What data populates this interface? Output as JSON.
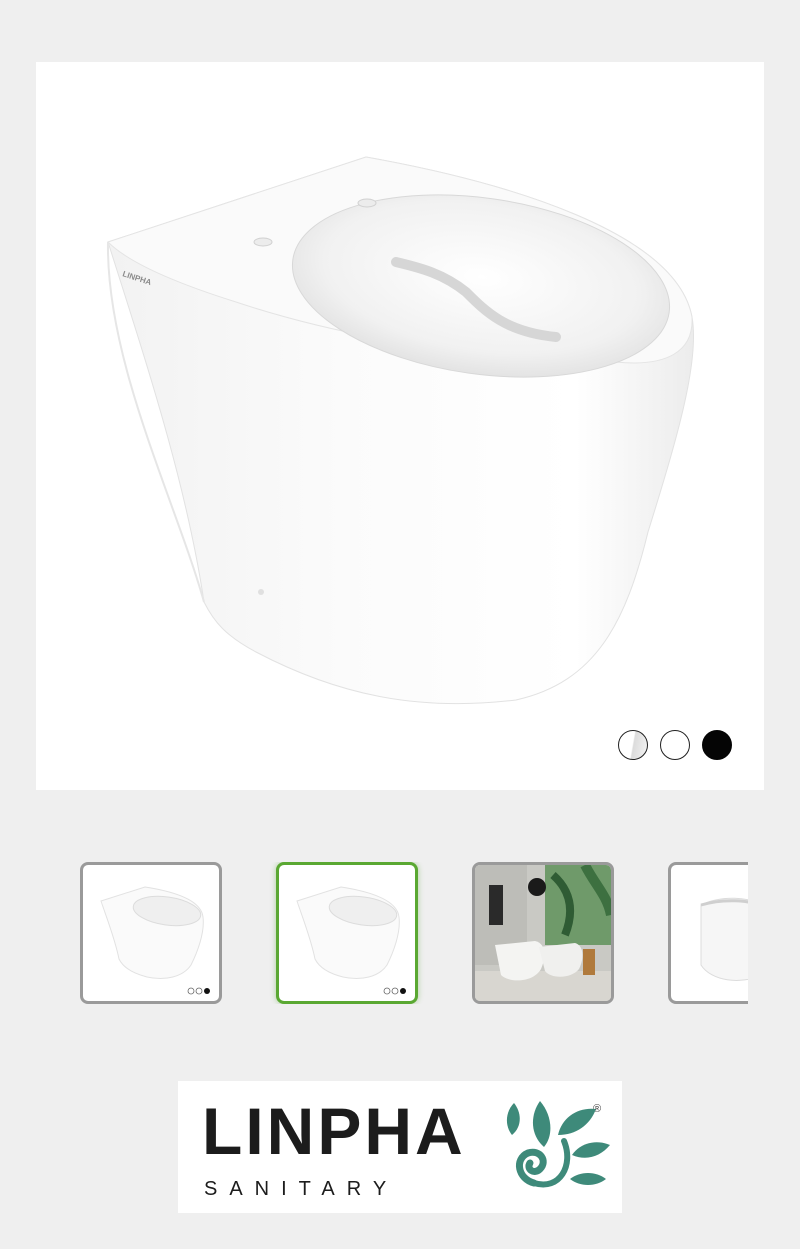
{
  "product_image": {
    "alt": "white back-to-wall toilet",
    "embossed_logo": "LINPHA"
  },
  "color_swatches": [
    {
      "name": "white-gloss",
      "color": "#ffffff"
    },
    {
      "name": "white-matte",
      "color": "#ffffff"
    },
    {
      "name": "black",
      "color": "#050505"
    }
  ],
  "thumbnails": [
    {
      "name": "toilet-front-view",
      "active": false
    },
    {
      "name": "toilet-front-view",
      "active": true
    },
    {
      "name": "bathroom-scene",
      "active": false
    },
    {
      "name": "toilet-side-view",
      "active": false
    }
  ],
  "brand": {
    "name": "LINPHA",
    "subtitle": "SANITARY",
    "registered_mark": "®",
    "leaf_color": "#3e8a7a"
  },
  "colors": {
    "accent_active": "#5aa832",
    "thumb_border": "#9a9a9a",
    "background": "#efefef"
  }
}
